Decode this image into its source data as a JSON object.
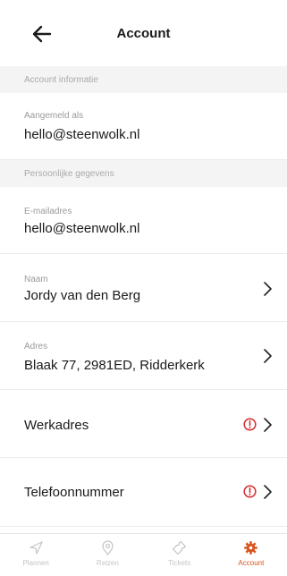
{
  "header": {
    "title": "Account"
  },
  "sections": {
    "account_info": "Account informatie",
    "personal": "Persoonlijke gegevens"
  },
  "logged_in": {
    "label": "Aangemeld als",
    "value": "hello@steenwolk.nl"
  },
  "email": {
    "label": "E-mailadres",
    "value": "hello@steenwolk.nl"
  },
  "name": {
    "label": "Naam",
    "value": "Jordy van den Berg"
  },
  "address": {
    "label": "Adres",
    "value": "Blaak 77, 2981ED, Ridderkerk"
  },
  "work_address": {
    "label": "Werkadres"
  },
  "phone": {
    "label": "Telefoonnummer"
  },
  "tabs": [
    {
      "label": "Plannen",
      "icon": "navigation-arrow-icon"
    },
    {
      "label": "Reizen",
      "icon": "location-pin-icon"
    },
    {
      "label": "Tickets",
      "icon": "ticket-icon"
    },
    {
      "label": "Account",
      "icon": "gear-icon"
    }
  ],
  "colors": {
    "accent": "#d9541e",
    "warning": "#d42a2a",
    "section_bg": "#f4f4f4"
  }
}
